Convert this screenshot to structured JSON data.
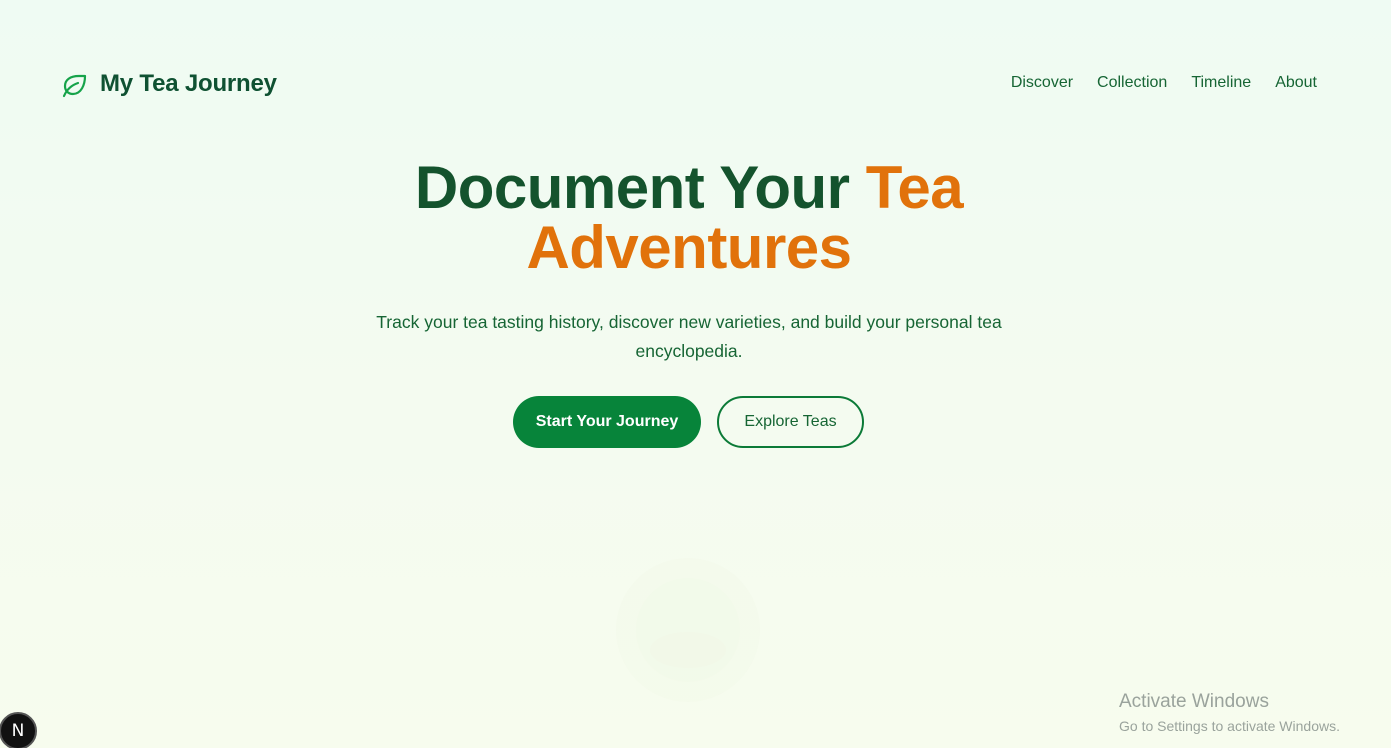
{
  "brand": {
    "name": "My Tea Journey",
    "icon": "leaf-icon"
  },
  "nav": {
    "items": [
      {
        "label": "Discover"
      },
      {
        "label": "Collection"
      },
      {
        "label": "Timeline"
      },
      {
        "label": "About"
      }
    ]
  },
  "hero": {
    "title_part1": "Document Your ",
    "title_accent_line1": "Tea",
    "title_accent_line2": "Adventures",
    "subtitle": "Track your tea tasting history, discover new varieties, and build your personal tea encyclopedia.",
    "primary_cta": "Start Your Journey",
    "secondary_cta": "Explore Teas"
  },
  "dev_badge": {
    "label": "N"
  },
  "os_watermark": {
    "title": "Activate Windows",
    "subtitle": "Go to Settings to activate Windows."
  },
  "colors": {
    "primary_green": "#07843a",
    "dark_green": "#14532d",
    "accent_orange": "#e1720b",
    "background": "#effbf3"
  }
}
